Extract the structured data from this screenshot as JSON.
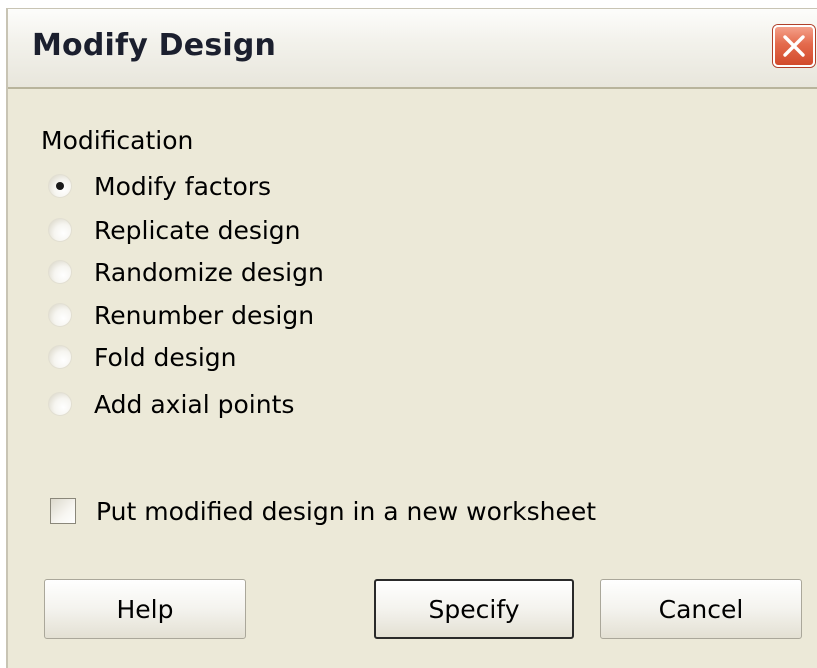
{
  "dialog": {
    "title": "Modify Design"
  },
  "modification": {
    "group_label": "Modification",
    "options": [
      {
        "label": "Modify factors",
        "checked": true
      },
      {
        "label": "Replicate design",
        "checked": false
      },
      {
        "label": "Randomize design",
        "checked": false
      },
      {
        "label": "Renumber design",
        "checked": false
      },
      {
        "label": "Fold design",
        "checked": false
      },
      {
        "label": "Add axial points",
        "checked": false
      }
    ]
  },
  "new_worksheet": {
    "label": "Put modified design in a new worksheet",
    "checked": false
  },
  "buttons": {
    "help": "Help",
    "specify": "Specify",
    "cancel": "Cancel"
  },
  "colors": {
    "dialog_bg": "#ece9d8",
    "close_button": "#e46a4c"
  },
  "icons": {
    "close": "close-x-icon"
  }
}
